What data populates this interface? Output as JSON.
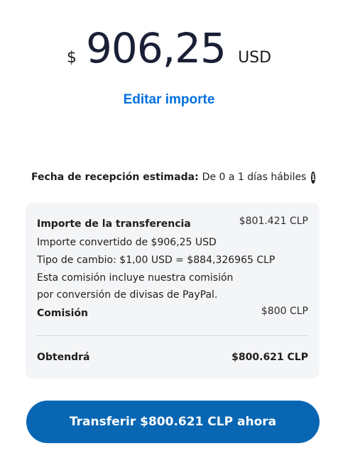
{
  "amount": {
    "symbol": "$",
    "value": "906,25",
    "currency": "USD"
  },
  "edit_link": "Editar importe",
  "eta": {
    "label": "Fecha de recepción estimada:",
    "value": "De 0 a 1 días hábiles",
    "icon": "info-icon"
  },
  "summary": {
    "transfer_label": "Importe de la transferencia",
    "transfer_value": "$801.421 CLP",
    "converted_line": "Importe convertido de $906,25 USD",
    "rate_line": "Tipo de cambio: $1,00 USD = $884,326965 CLP",
    "fee_note_line1": "Esta comisión incluye nuestra comisión",
    "fee_note_line2": "por conversión de divisas de PayPal.",
    "fee_label": "Comisión",
    "fee_value": "$800 CLP",
    "receive_label": "Obtendrá",
    "receive_value": "$800.621 CLP"
  },
  "button": {
    "label": "Transferir $800.621 CLP ahora"
  },
  "colors": {
    "accent_link": "#0070e0",
    "button_bg": "#0866b3",
    "card_bg": "#f4f5f7"
  }
}
